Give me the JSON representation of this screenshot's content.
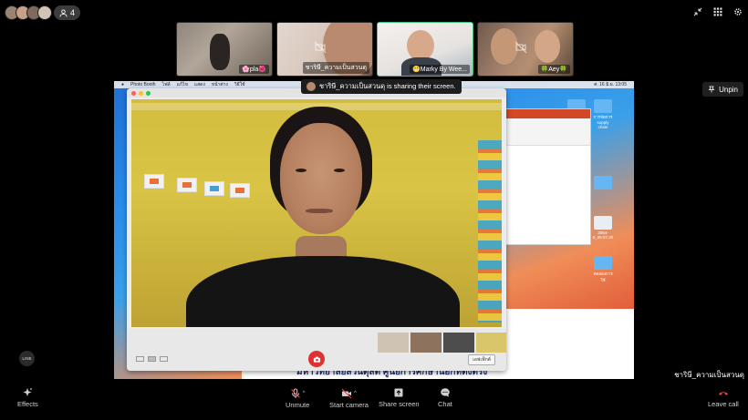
{
  "participants": {
    "count": "4"
  },
  "thumbnails": [
    {
      "label": "🌸pla🌺",
      "muted": true
    },
    {
      "label": "ชาริษี_ความเป็นสวนดุ",
      "muted": true
    },
    {
      "label": "😬Marky By Wee...",
      "muted": true
    },
    {
      "label": "🍀Aey🍀",
      "muted": true
    }
  ],
  "share_banner": {
    "text": "ชาริษี_ความเป็นสวนดุ is sharing their screen."
  },
  "unpin": {
    "label": "Unpin"
  },
  "shared_screen": {
    "menu_items": [
      "Photo Booth",
      "ไฟล์",
      "แก้ไข",
      "แสดง",
      "หน้าต่าง",
      "วิธีใช้"
    ],
    "menu_clock": "ศ. 16 มิ.ย.  13:05",
    "photo_booth_title": "Photo Booth",
    "photo_booth_effects": "เอฟเฟ็กต์",
    "doc_heading": "มหาวิทยาลัยสวนดุสิต ศูนย์การศึกษานอกที่ตั้งตรัง",
    "desktop_icons": [
      "การจัดการ supply chain",
      "",
      "ทดลองการใช้",
      "2564-0_05.57.30",
      "งานที่ต้องเสร็จ",
      "ออกแบบงานมหาวิทยาลัย"
    ]
  },
  "presenter_name": "ชาริษี_ความเป็นสวนดุ",
  "line_logo": "LINE",
  "toolbar": {
    "effects": "Effects",
    "unmute": "Unmute",
    "start_camera": "Start camera",
    "share_screen": "Share screen",
    "chat": "Chat",
    "leave_call": "Leave call"
  },
  "colors": {
    "leave": "#e5484d",
    "active_border": "#3ec27a",
    "shutter": "#e03131"
  }
}
